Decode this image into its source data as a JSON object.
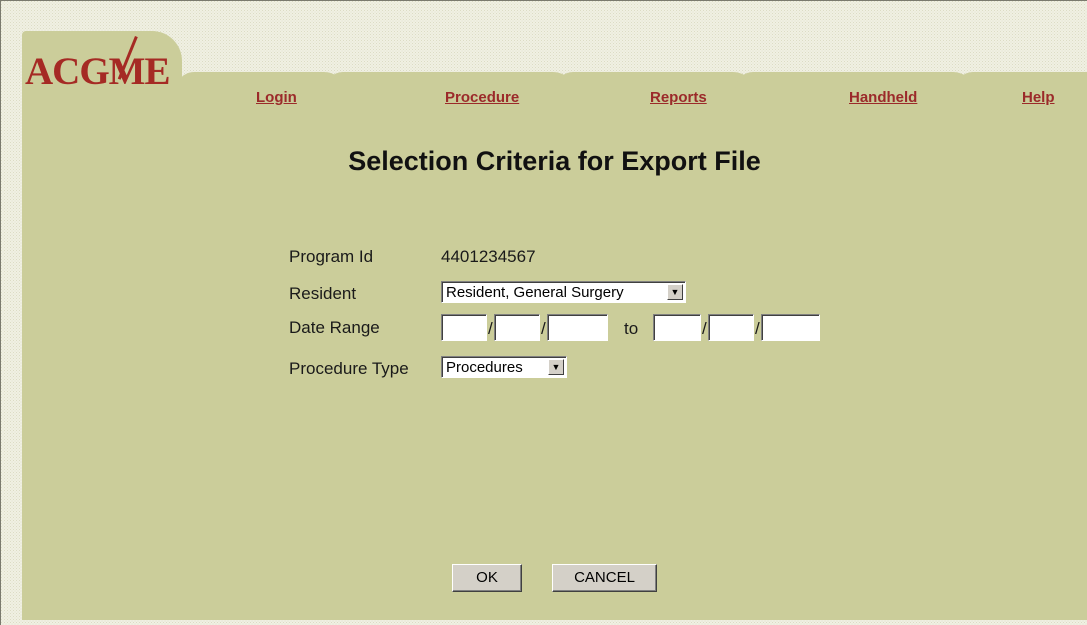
{
  "logo": {
    "text": "ACGME"
  },
  "nav": {
    "tabs": [
      {
        "label": "Login"
      },
      {
        "label": "Procedure"
      },
      {
        "label": "Reports"
      },
      {
        "label": "Handheld"
      },
      {
        "label": "Help"
      }
    ]
  },
  "page": {
    "title": "Selection Criteria for Export File"
  },
  "form": {
    "program_id_label": "Program Id",
    "program_id_value": "4401234567",
    "resident_label": "Resident",
    "resident_selected": "Resident, General Surgery",
    "date_range_label": "Date Range",
    "date_separator": "/",
    "date_to_label": "to",
    "procedure_type_label": "Procedure Type",
    "procedure_type_selected": "Procedures"
  },
  "buttons": {
    "ok_label": "OK",
    "cancel_label": "CANCEL"
  },
  "colors": {
    "accent": "#9b2a2a",
    "panel": "#cbcd9a",
    "background": "#f1f1e4"
  }
}
